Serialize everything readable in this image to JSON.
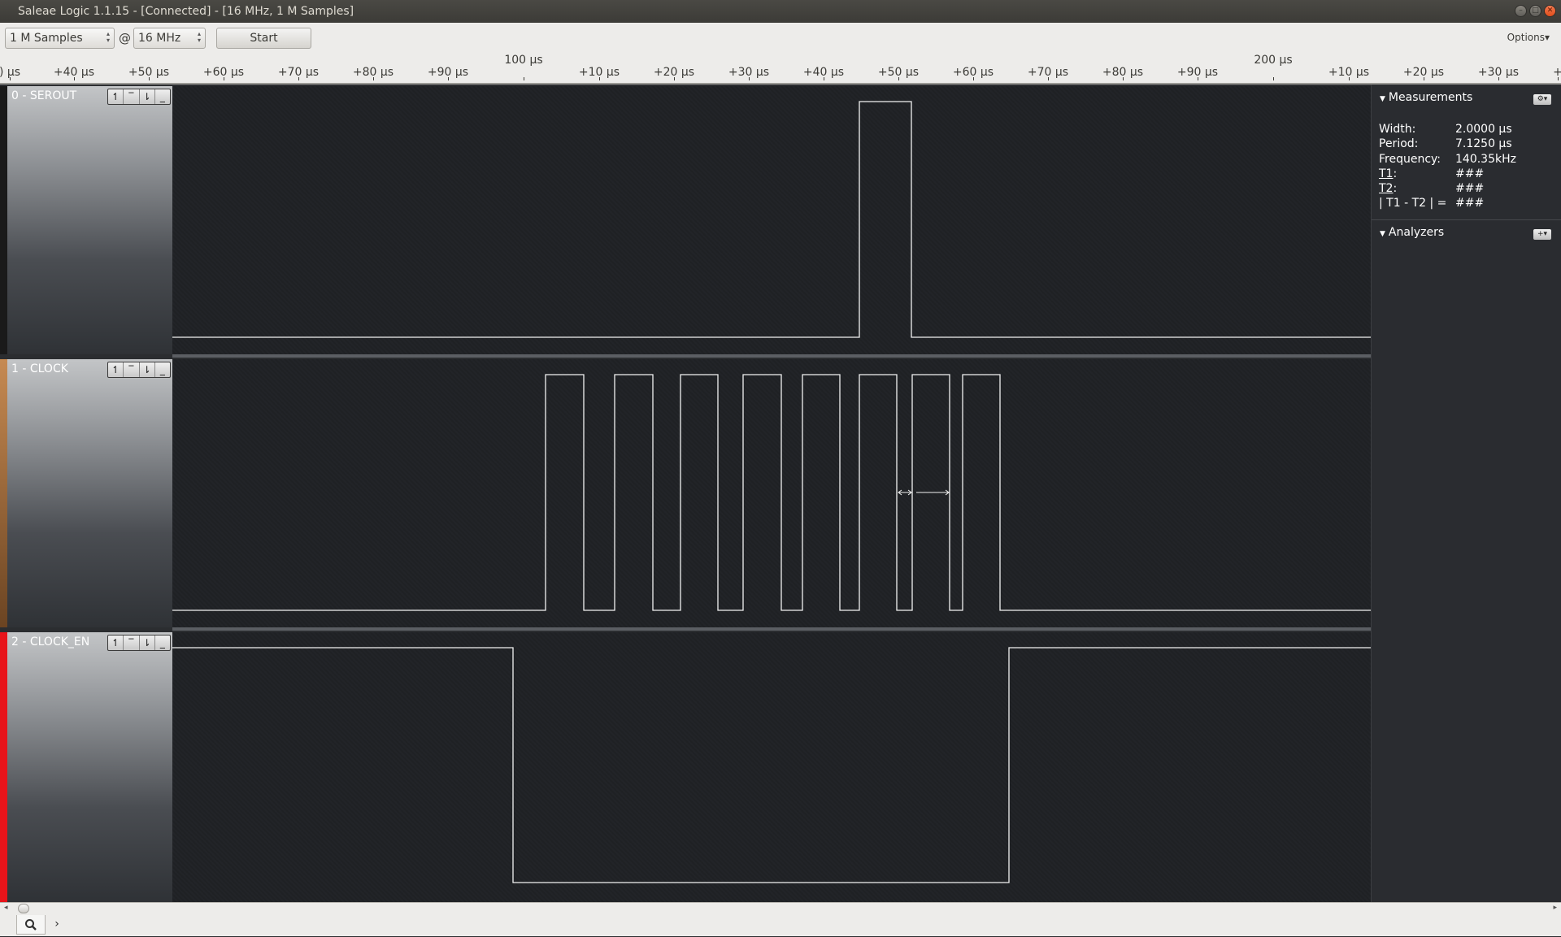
{
  "window": {
    "title": "Saleae Logic 1.1.15 - [Connected] - [16 MHz, 1 M Samples]",
    "minimize_icon": "minimize-icon",
    "maximize_icon": "maximize-icon",
    "close_icon": "close-icon"
  },
  "toolbar": {
    "samples_value": "1 M Samples",
    "at_symbol": "@",
    "rate_value": "16 MHz",
    "start_label": "Start",
    "options_label": "Options▾"
  },
  "ruler": {
    "major_labels": [
      "100 µs",
      "200 µs"
    ],
    "minor_labels": [
      ")  µs",
      "+40 µs",
      "+50 µs",
      "+60 µs",
      "+70 µs",
      "+80 µs",
      "+90 µs",
      "+10 µs",
      "+20 µs",
      "+30 µs",
      "+40 µs",
      "+50 µs",
      "+60 µs",
      "+70 µs",
      "+80 µs",
      "+90 µs",
      "+10 µs",
      "+20 µs",
      "+30 µs",
      "+"
    ]
  },
  "channels": [
    {
      "name": "0 - SEROUT",
      "color": "#1a1a1a"
    },
    {
      "name": "1 - CLOCK",
      "color": "#8b5a2b"
    },
    {
      "name": "2 - CLOCK_EN",
      "color": "#e8141a"
    }
  ],
  "trigger_buttons": [
    "rising-edge-icon",
    "high-level-icon",
    "falling-edge-icon",
    "low-level-icon"
  ],
  "trigger_glyphs": [
    "↿",
    "‾",
    "⇂",
    "_"
  ],
  "measurements": {
    "header": "Measurements",
    "width_label": "Width:",
    "width_value": "2.0000 µs",
    "period_label": "Period:",
    "period_value": "7.1250 µs",
    "frequency_label": "Frequency:",
    "frequency_value": "140.35kHz",
    "t1_label": "T1",
    "t1_value": "###",
    "t2_label": "T2",
    "t2_value": "###",
    "diff_label": "| T1 - T2 | =",
    "diff_value": "###"
  },
  "analyzers": {
    "header": "Analyzers",
    "add_button": "+▾"
  },
  "panel_gear": "⚙▾",
  "bottom_tabs": [
    "search-icon",
    "chevron-right-icon"
  ],
  "bottom_glyphs": [
    "🔍",
    "›"
  ]
}
